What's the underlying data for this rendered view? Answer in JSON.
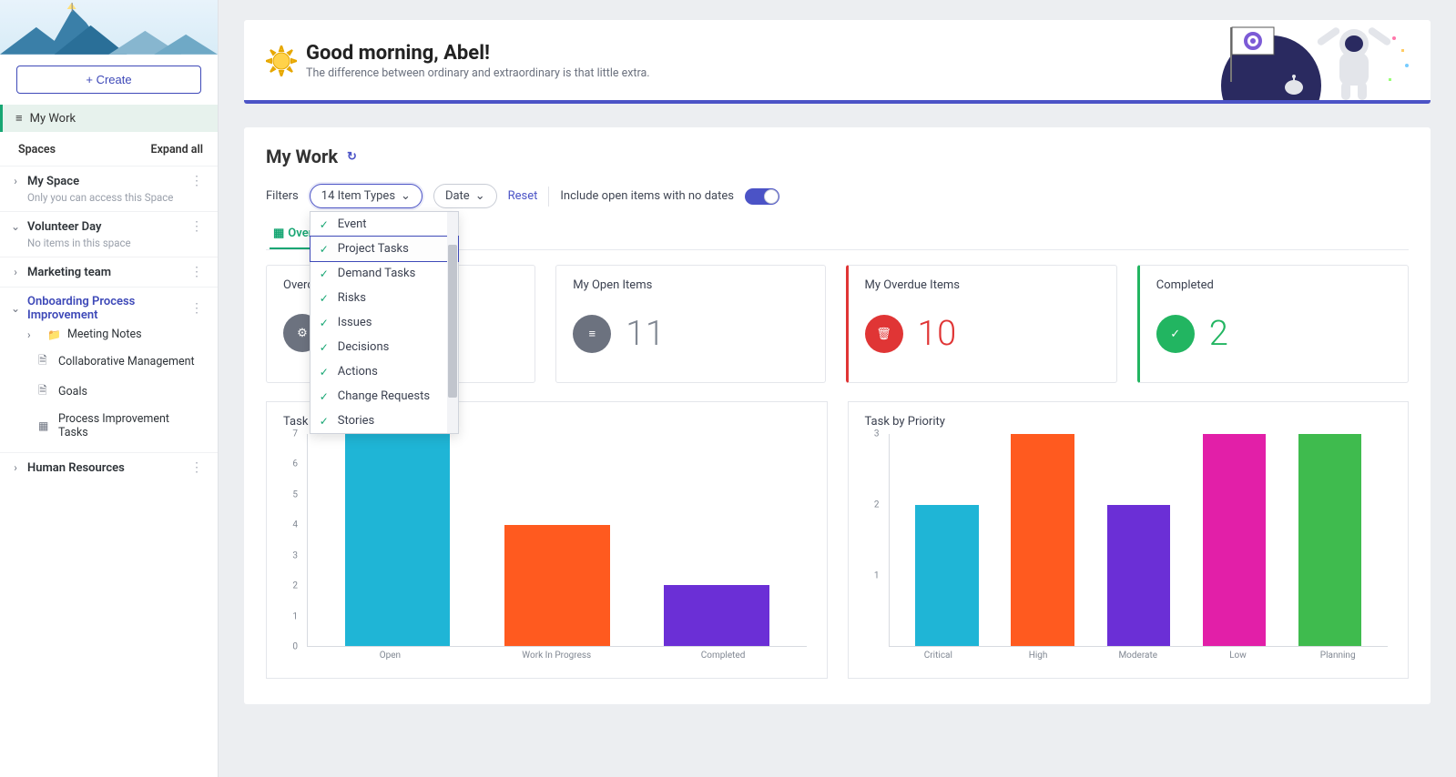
{
  "sidebar": {
    "create_label": "Create",
    "mywork_label": "My Work",
    "spaces_label": "Spaces",
    "expand_label": "Expand all",
    "spaces": [
      {
        "name": "My Space",
        "open": false,
        "sub": "Only you can access this Space"
      },
      {
        "name": "Volunteer Day",
        "open": true,
        "sub": "No items in this space"
      },
      {
        "name": "Marketing team",
        "open": false
      },
      {
        "name": "Onboarding Process Improvement",
        "open": true,
        "accent": true,
        "children": [
          {
            "label": "Meeting Notes",
            "icon": "folder",
            "chev": true
          },
          {
            "label": "Collaborative Management",
            "icon": "doc",
            "indent": true
          },
          {
            "label": "Goals",
            "icon": "doc",
            "indent": true
          },
          {
            "label": "Process Improvement Tasks",
            "icon": "grid",
            "indent": true
          }
        ]
      },
      {
        "name": "Human Resources",
        "open": false
      }
    ]
  },
  "banner": {
    "greeting": "Good morning, Abel!",
    "tagline": "The difference between ordinary and extraordinary is that little extra."
  },
  "panel": {
    "title": "My Work",
    "filters_label": "Filters",
    "item_types_label": "14 Item Types",
    "date_label": "Date",
    "reset_label": "Reset",
    "include_label": "Include open items with no dates",
    "tab_overview": "Overview",
    "dropdown_items": [
      "Event",
      "Project Tasks",
      "Demand Tasks",
      "Risks",
      "Issues",
      "Decisions",
      "Actions",
      "Change Requests",
      "Stories"
    ],
    "dropdown_selected_index": 1,
    "kpis": [
      {
        "title": "Overdue",
        "value": "",
        "icon_bg": "#6c727f",
        "accent": ""
      },
      {
        "title": "My Open Items",
        "value": "11",
        "icon_bg": "#6c727f",
        "accent": ""
      },
      {
        "title": "My Overdue Items",
        "value": "10",
        "icon_bg": "#e03535",
        "accent": "red"
      },
      {
        "title": "Completed",
        "value": "2",
        "icon_bg": "#22b561",
        "accent": "green"
      }
    ],
    "chart1_title": "Task by State",
    "chart2_title": "Task by Priority"
  },
  "chart_data": [
    {
      "type": "bar",
      "title": "Task by State",
      "categories": [
        "Open",
        "Work In Progress",
        "Completed"
      ],
      "values": [
        7,
        4,
        2
      ],
      "colors": [
        "#1fb5d6",
        "#ff5a1f",
        "#6b2fd6"
      ],
      "ylim": [
        0,
        7
      ],
      "yticks": [
        0,
        1,
        2,
        3,
        4,
        5,
        6,
        7
      ]
    },
    {
      "type": "bar",
      "title": "Task by Priority",
      "categories": [
        "Critical",
        "High",
        "Moderate",
        "Low",
        "Planning"
      ],
      "values": [
        2,
        3,
        2,
        3,
        3
      ],
      "colors": [
        "#1fb5d6",
        "#ff5a1f",
        "#6b2fd6",
        "#e21fa8",
        "#3fbb4e"
      ],
      "ylim": [
        0,
        3
      ],
      "yticks": [
        1,
        2,
        3
      ]
    }
  ]
}
